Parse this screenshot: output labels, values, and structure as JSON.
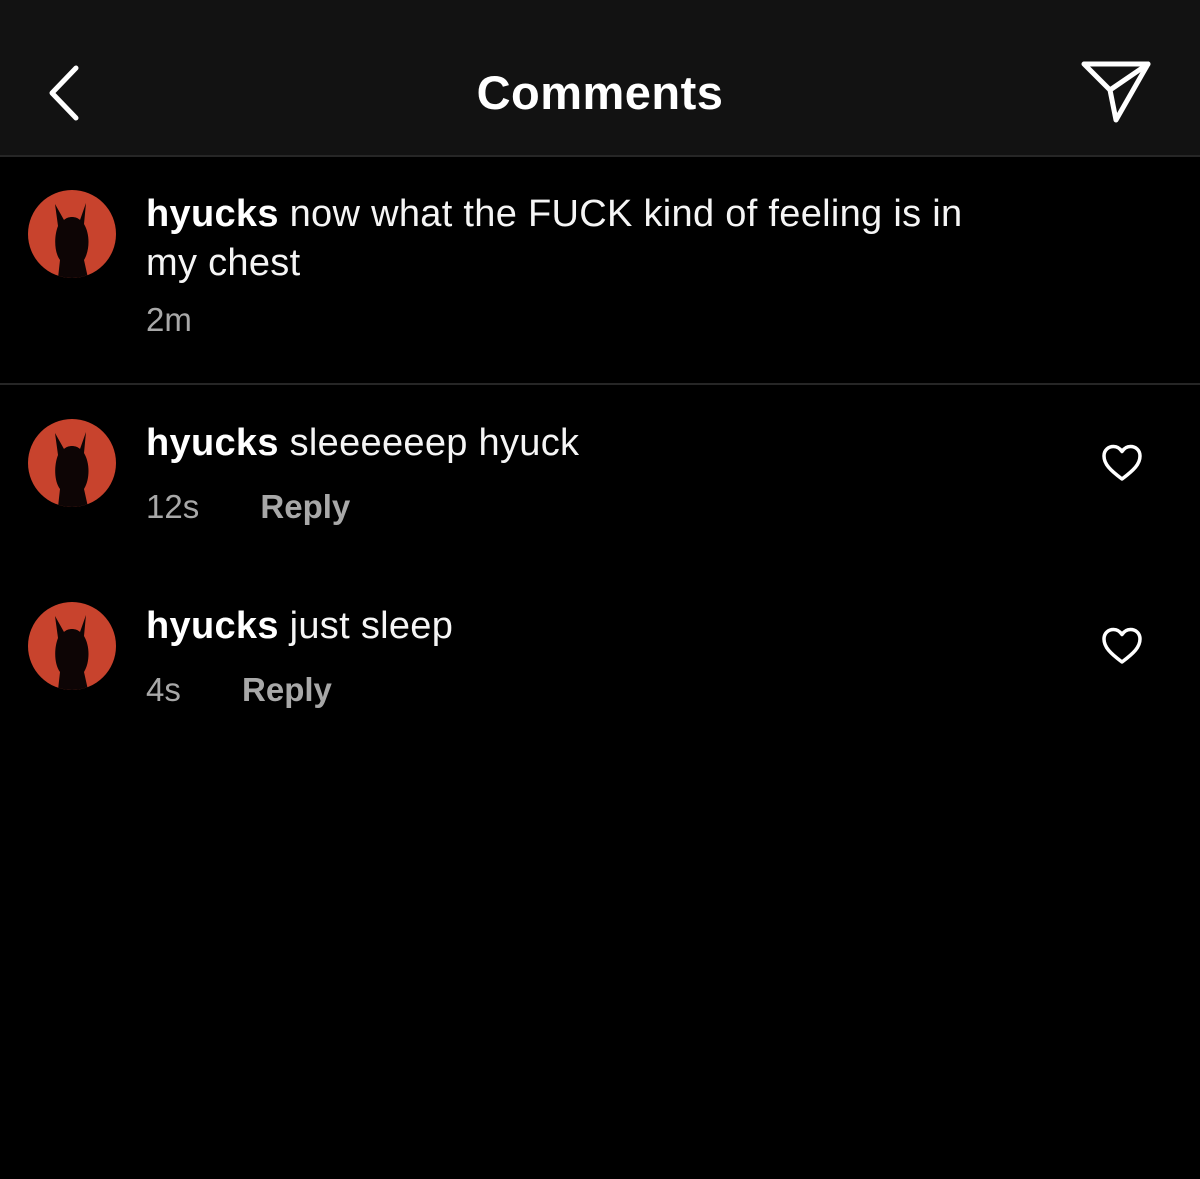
{
  "header": {
    "title": "Comments",
    "back_icon": "chevron-left-icon",
    "share_icon": "paper-plane-icon"
  },
  "colors": {
    "background": "#000000",
    "header_background": "#121212",
    "divider": "#262626",
    "meta_text": "#a8a8a8",
    "avatar_red": "#c8432d"
  },
  "caption": {
    "username": "hyucks",
    "text_line1": "now what the FUCK kind of feeling is in",
    "text_line2": "my chest",
    "time": "2m"
  },
  "comments": [
    {
      "username": "hyucks",
      "text": "sleeeeeep hyuck",
      "time": "12s",
      "reply_label": "Reply",
      "like_icon": "heart-outline-icon"
    },
    {
      "username": "hyucks",
      "text": "just sleep",
      "time": "4s",
      "reply_label": "Reply",
      "like_icon": "heart-outline-icon"
    }
  ]
}
